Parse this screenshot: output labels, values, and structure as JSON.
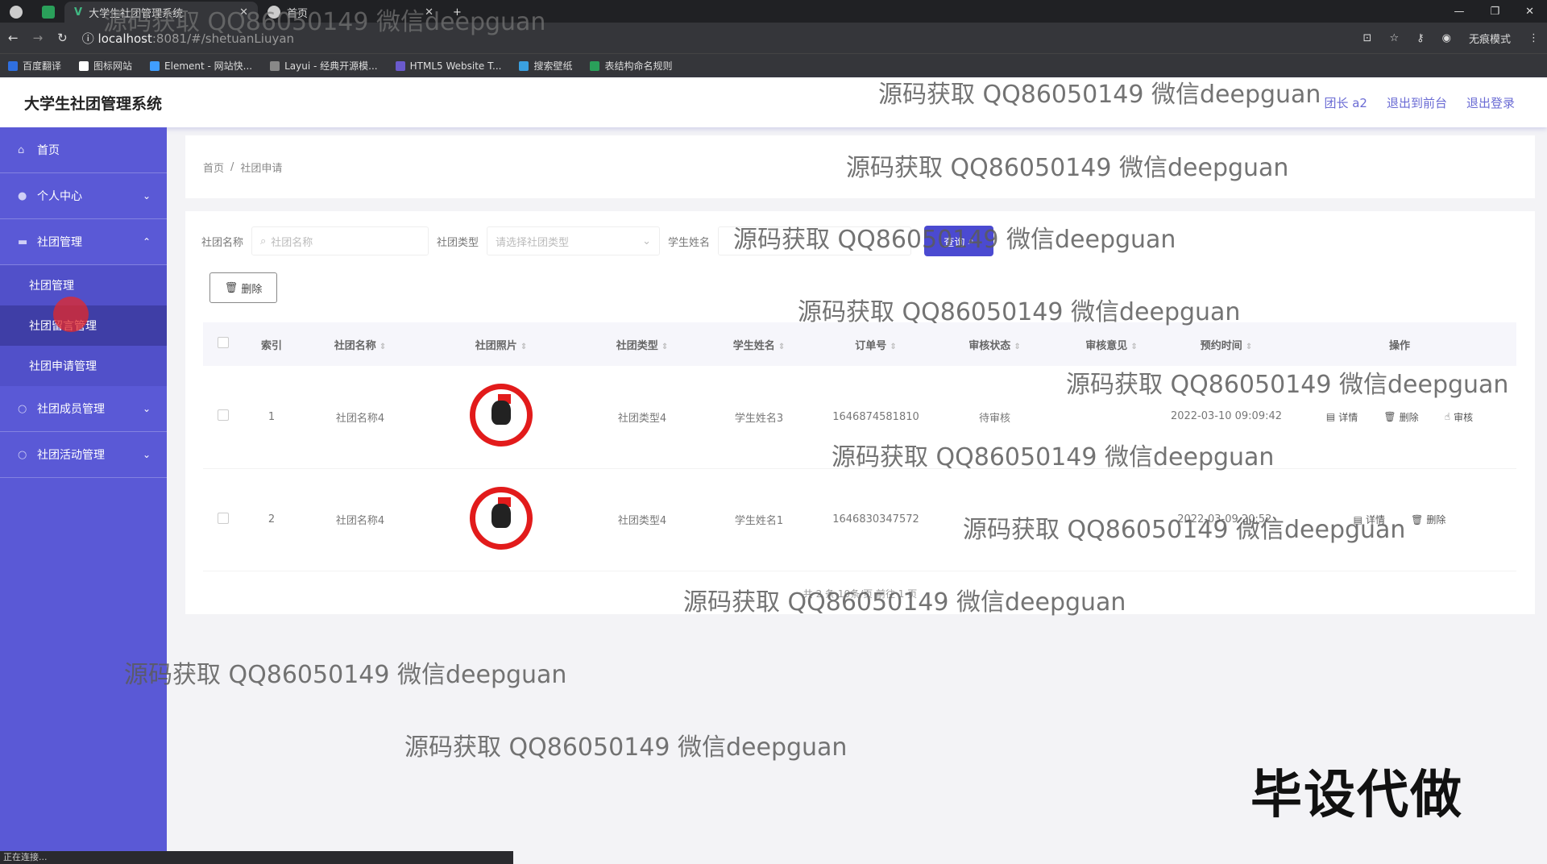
{
  "browser": {
    "tabs": [
      {
        "label": "大学生社团管理系统",
        "active": true
      },
      {
        "label": "首页",
        "active": false
      }
    ],
    "new_tab": "+",
    "url_host": "localhost",
    "url_path": ":8081/#/shetuanLiuyan",
    "incognito_label": "无痕模式",
    "bookmarks": [
      "百度翻译",
      "图标网站",
      "Element - 网站快...",
      "Layui - 经典开源模...",
      "HTML5 Website T...",
      "搜索壁纸",
      "表结构命名规则"
    ]
  },
  "header": {
    "title": "大学生社团管理系统",
    "links": [
      "团长 a2",
      "退出到前台",
      "退出登录"
    ]
  },
  "sidebar": {
    "items": [
      {
        "label": "首页",
        "icon": "home-icon",
        "expandable": false
      },
      {
        "label": "个人中心",
        "icon": "user-icon",
        "expandable": true,
        "open": false
      },
      {
        "label": "社团管理",
        "icon": "folder-icon",
        "expandable": true,
        "open": true,
        "children": [
          {
            "label": "社团管理",
            "active": false
          },
          {
            "label": "社团留言管理",
            "active": true
          },
          {
            "label": "社团申请管理",
            "active": false
          }
        ]
      },
      {
        "label": "社团成员管理",
        "icon": "circle-icon",
        "expandable": true,
        "open": false
      },
      {
        "label": "社团活动管理",
        "icon": "circle-icon",
        "expandable": true,
        "open": false
      }
    ]
  },
  "breadcrumb": {
    "home": "首页",
    "sep": "/",
    "current": "社团申请"
  },
  "search": {
    "name_label": "社团名称",
    "name_placeholder": "社团名称",
    "type_label": "社团类型",
    "type_placeholder": "请选择社团类型",
    "student_label": "学生姓名",
    "query_label": "查询"
  },
  "toolbar": {
    "delete_label": "删除"
  },
  "table": {
    "columns": [
      "索引",
      "社团名称",
      "社团照片",
      "社团类型",
      "学生姓名",
      "订单号",
      "审核状态",
      "审核意见",
      "预约时间",
      "操作"
    ],
    "rows": [
      {
        "index": "1",
        "name": "社团名称4",
        "type": "社团类型4",
        "student": "学生姓名3",
        "order": "1646874581810",
        "status": "待审核",
        "opinion": "",
        "time": "2022-03-10 09:09:42",
        "actions": [
          "详情",
          "删除",
          "审核"
        ]
      },
      {
        "index": "2",
        "name": "社团名称4",
        "type": "社团类型4",
        "student": "学生姓名1",
        "order": "1646830347572",
        "status": "",
        "opinion": "",
        "time": "2022-03-09 20:52:",
        "actions": [
          "详情",
          "删除"
        ]
      }
    ]
  },
  "pager": {
    "text": "共 2 条    10条/页    前往  1  页"
  },
  "watermarks": [
    "源码获取 QQ86050149 微信deepguan",
    "源码获取 QQ86050149 微信deepguan",
    "源码获取 QQ86050149 微信deepguan",
    "源码获取 QQ86050149 微信deepguan",
    "源码获取 QQ86050149 微信deepguan",
    "源码获取 QQ86050149 微信deepguan",
    "源码获取 QQ86050149 微信deepguan",
    "源码获取 QQ86050149 微信deepguan",
    "源码获取 QQ86050149 微信deepguan",
    "源码获取 QQ86050149 微信deepguan",
    "源码获取 QQ86050149 微信deepguan"
  ],
  "overlay_tag": "毕设代做",
  "status_text": "正在连接..."
}
